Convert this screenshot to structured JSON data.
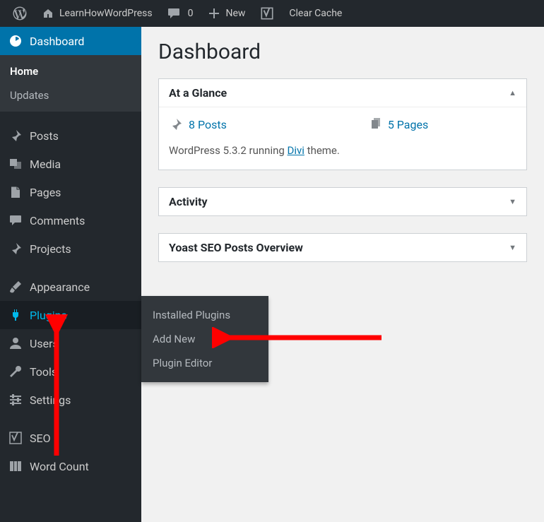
{
  "adminbar": {
    "site_name": "LearnHowWordPress",
    "comments_count": "0",
    "new_label": "New",
    "clear_cache": "Clear Cache"
  },
  "sidebar": {
    "dashboard": "Dashboard",
    "dashboard_sub": {
      "home": "Home",
      "updates": "Updates"
    },
    "posts": "Posts",
    "media": "Media",
    "pages": "Pages",
    "comments": "Comments",
    "projects": "Projects",
    "appearance": "Appearance",
    "plugins": "Plugins",
    "users": "Users",
    "tools": "Tools",
    "settings": "Settings",
    "seo": "SEO",
    "word_count": "Word Count"
  },
  "plugins_flyout": {
    "installed": "Installed Plugins",
    "add_new": "Add New",
    "editor": "Plugin Editor"
  },
  "page": {
    "title": "Dashboard"
  },
  "glance": {
    "title": "At a Glance",
    "posts": "8 Posts",
    "pages": "5 Pages",
    "version_prefix": "WordPress 5.3.2 running ",
    "theme": "Divi",
    "version_suffix": " theme."
  },
  "activity": {
    "title": "Activity"
  },
  "yoast": {
    "title": "Yoast SEO Posts Overview"
  }
}
